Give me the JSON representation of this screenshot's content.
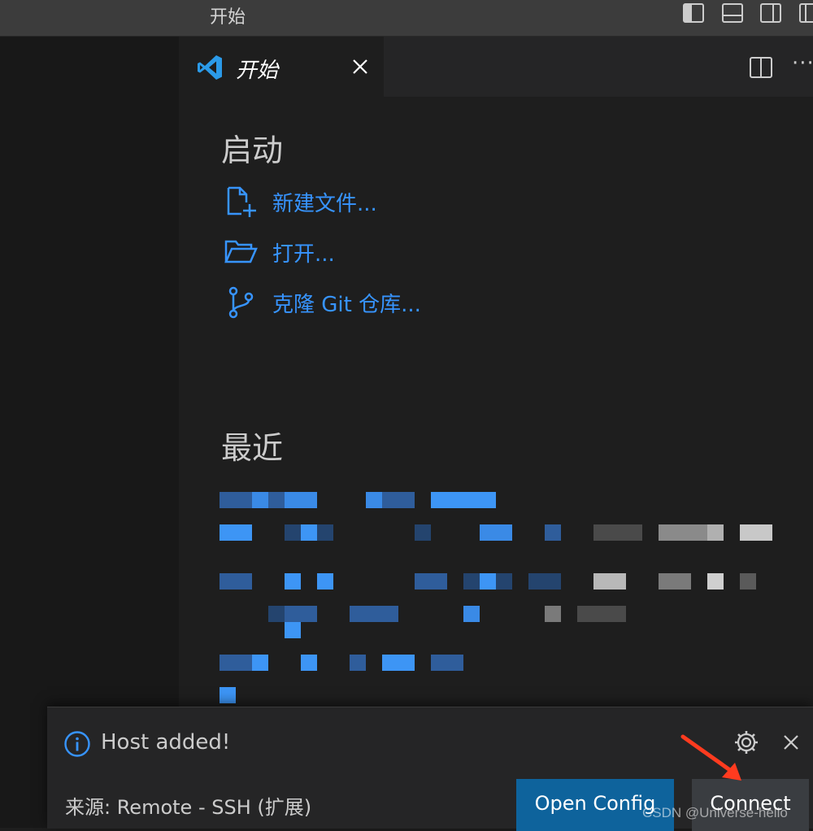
{
  "titlebar": {
    "title": "开始"
  },
  "tab": {
    "label": "开始",
    "icon": "vscode-logo-icon"
  },
  "start": {
    "heading": "启动",
    "actions": [
      {
        "label": "新建文件...",
        "icon": "new-file-icon"
      },
      {
        "label": "打开...",
        "icon": "folder-open-icon"
      },
      {
        "label": "克隆 Git 仓库...",
        "icon": "source-control-icon"
      }
    ]
  },
  "recent": {
    "heading": "最近"
  },
  "notification": {
    "message": "Host added!",
    "source": "来源: Remote - SSH (扩展)",
    "open_config_label": "Open Config",
    "connect_label": "Connect"
  },
  "watermark": "CSDN @Universe-hello",
  "colors": {
    "link": "#3794ff",
    "primary_button": "#0e639c",
    "secondary_button": "#3a3d41",
    "arrow": "#ff3b1f"
  }
}
